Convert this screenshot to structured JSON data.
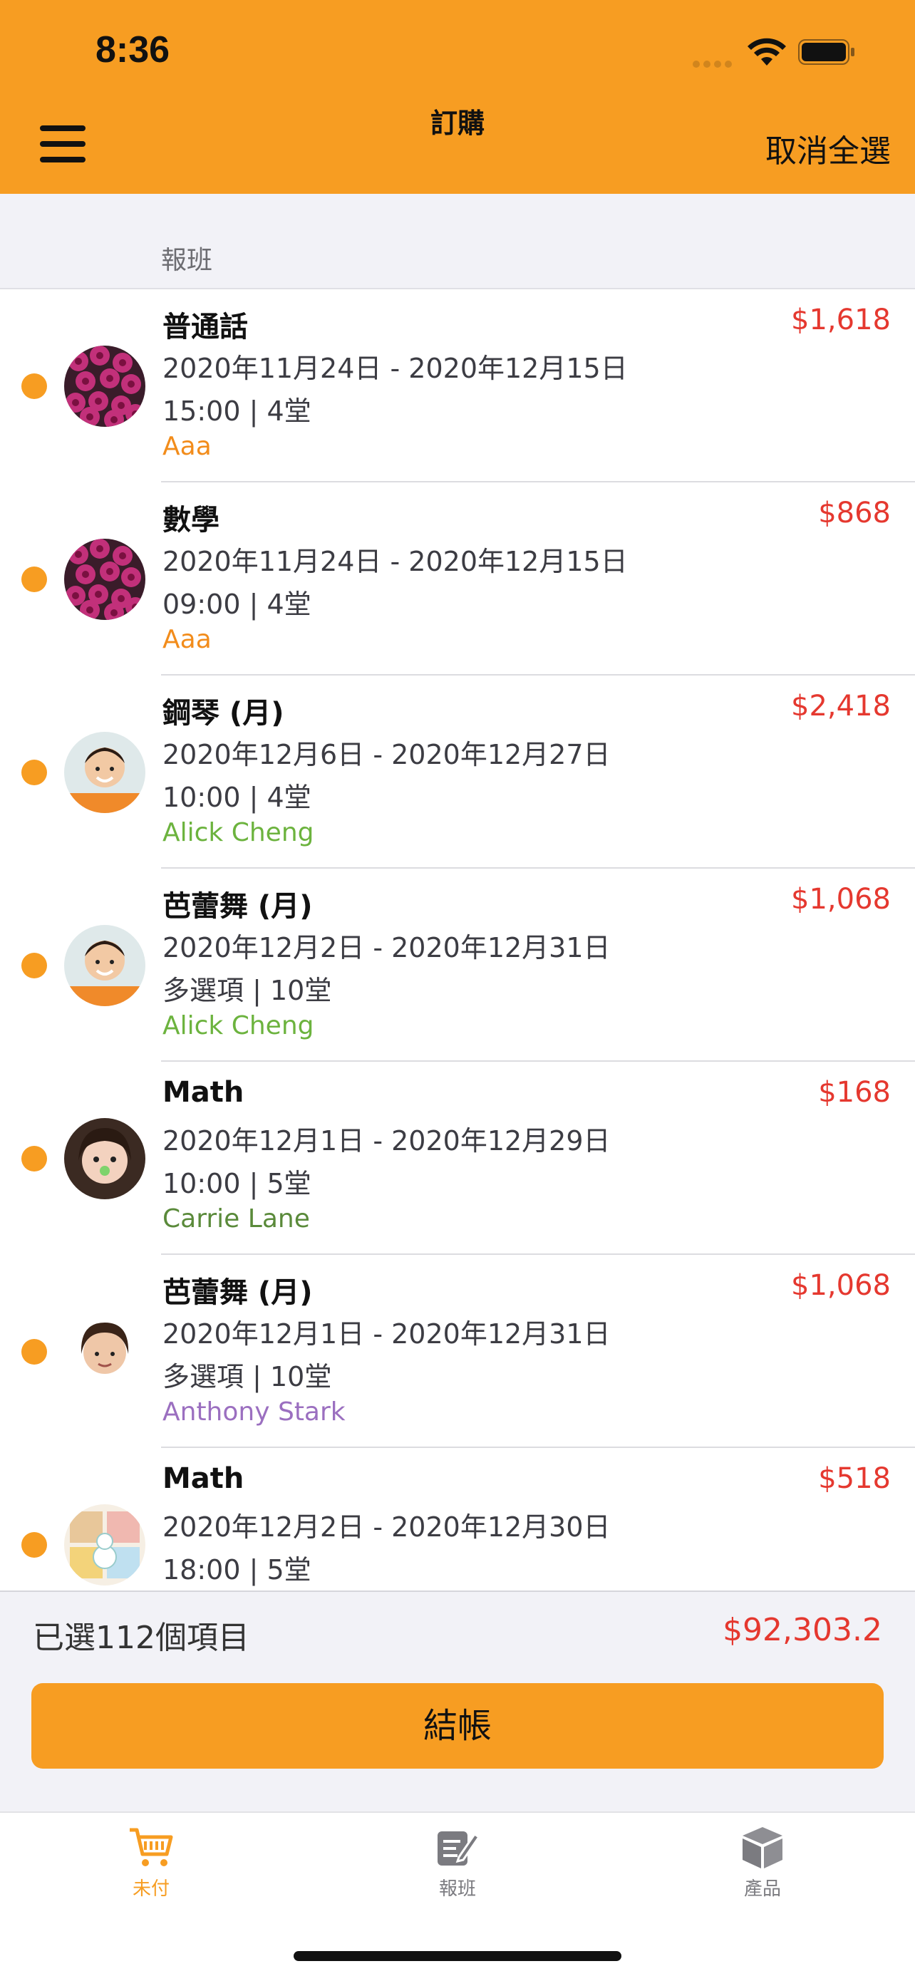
{
  "status_bar": {
    "time": "8:36"
  },
  "nav": {
    "title": "訂購",
    "deselect_all": "取消全選"
  },
  "section": {
    "label": "報班"
  },
  "rows": [
    {
      "title": "普通話",
      "price": "$1,618",
      "dates": "2020年11月24日 - 2020年12月15日",
      "time": "15:00 | 4堂",
      "student": "Aaa",
      "student_color": "#f28c1b",
      "avatar": "flowers"
    },
    {
      "title": "數學",
      "price": "$868",
      "dates": "2020年11月24日 - 2020年12月15日",
      "time": "09:00 | 4堂",
      "student": "Aaa",
      "student_color": "#f28c1b",
      "avatar": "flowers"
    },
    {
      "title": "鋼琴 (月)",
      "price": "$2,418",
      "dates": "2020年12月6日 - 2020年12月27日",
      "time": "10:00 | 4堂",
      "student": "Alick Cheng",
      "student_color": "#6cb33e",
      "avatar": "boy-orange"
    },
    {
      "title": "芭蕾舞 (月)",
      "price": "$1,068",
      "dates": "2020年12月2日 - 2020年12月31日",
      "time": "多選項 | 10堂",
      "student": "Alick Cheng",
      "student_color": "#6cb33e",
      "avatar": "boy-orange"
    },
    {
      "title": "Math",
      "price": "$168",
      "dates": "2020年12月1日 - 2020年12月29日",
      "time": "10:00 | 5堂",
      "student": "Carrie Lane",
      "student_color": "#5a8a3a",
      "avatar": "girl"
    },
    {
      "title": "芭蕾舞 (月)",
      "price": "$1,068",
      "dates": "2020年12月1日 - 2020年12月31日",
      "time": "多選項 | 10堂",
      "student": "Anthony Stark",
      "student_color": "#9b6fc0",
      "avatar": "boy-white"
    },
    {
      "title": "Math",
      "price": "$518",
      "dates": "2020年12月2日 - 2020年12月30日",
      "time": "18:00 | 5堂",
      "student": "",
      "student_color": "#333333",
      "avatar": "cartoon"
    }
  ],
  "footer": {
    "selected_count": "已選112個項目",
    "total": "$92,303.2",
    "checkout": "結帳"
  },
  "tabs": [
    {
      "label": "未付",
      "icon": "cart-icon",
      "active": true
    },
    {
      "label": "報班",
      "icon": "edit-note-icon",
      "active": false
    },
    {
      "label": "產品",
      "icon": "box-icon",
      "active": false
    }
  ],
  "colors": {
    "accent": "#f79d22",
    "price": "#e5382f",
    "tab_inactive": "#7b7b80"
  }
}
